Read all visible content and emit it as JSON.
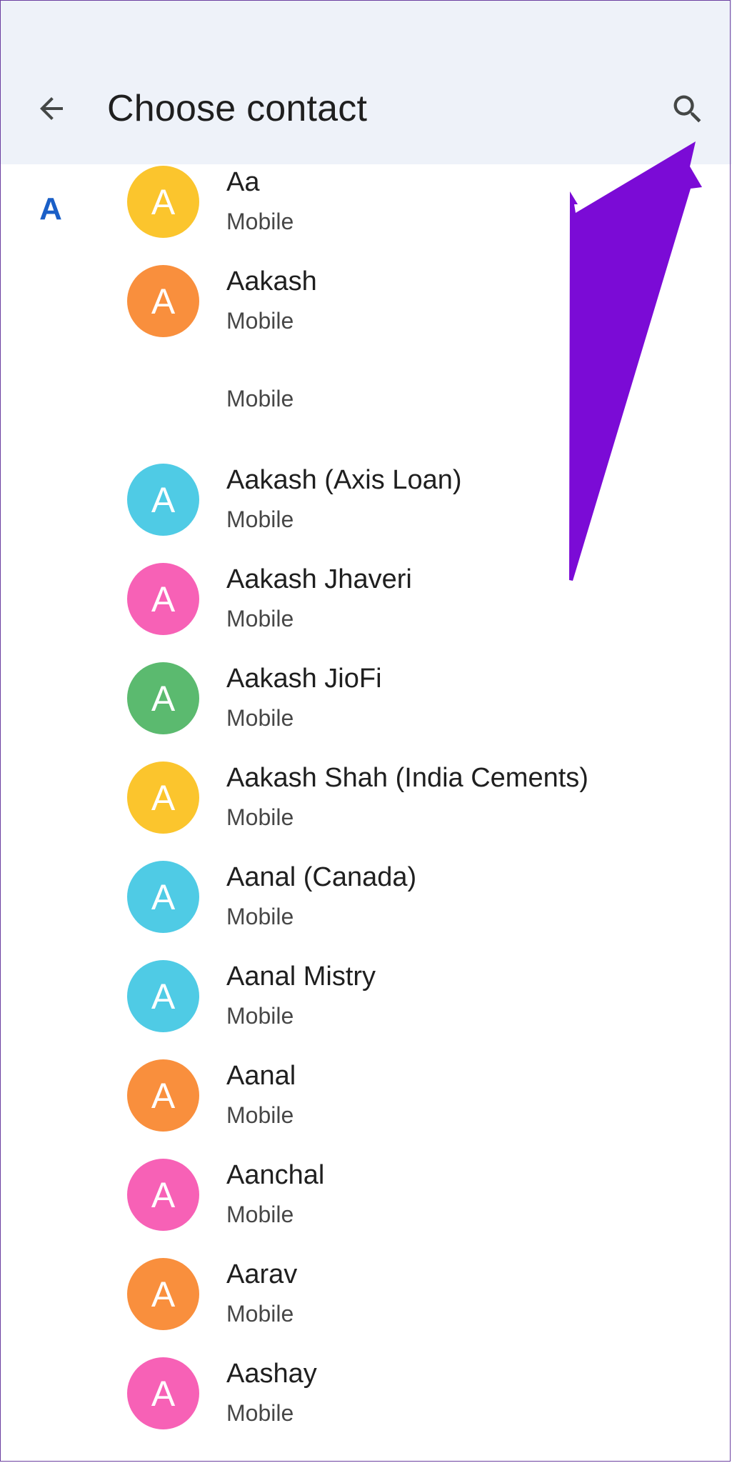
{
  "header": {
    "title": "Choose contact",
    "back_icon": "arrow-left-icon",
    "search_icon": "search-icon"
  },
  "section": {
    "letter": "A"
  },
  "annotation": {
    "arrow_color": "#7b0bd6",
    "arrow_icon": "pointer-arrow"
  },
  "contacts": [
    {
      "name": "Aa",
      "type": "Mobile",
      "initial": "A",
      "color": "#fbc52d"
    },
    {
      "name": "Aakash",
      "type": "Mobile",
      "initial": "A",
      "color": "#f98f3d"
    },
    {
      "name": "",
      "type": "Mobile",
      "initial": "",
      "color": ""
    },
    {
      "name": "Aakash (Axis Loan)",
      "type": "Mobile",
      "initial": "A",
      "color": "#4fcbe5"
    },
    {
      "name": "Aakash Jhaveri",
      "type": "Mobile",
      "initial": "A",
      "color": "#f761b6"
    },
    {
      "name": "Aakash JioFi",
      "type": "Mobile",
      "initial": "A",
      "color": "#5bba6f"
    },
    {
      "name": "Aakash Shah (India Cements)",
      "type": "Mobile",
      "initial": "A",
      "color": "#fbc52d"
    },
    {
      "name": "Aanal (Canada)",
      "type": "Mobile",
      "initial": "A",
      "color": "#4fcbe5"
    },
    {
      "name": "Aanal Mistry",
      "type": "Mobile",
      "initial": "A",
      "color": "#4fcbe5"
    },
    {
      "name": "Aanal",
      "type": "Mobile",
      "initial": "A",
      "color": "#f98f3d"
    },
    {
      "name": "Aanchal",
      "type": "Mobile",
      "initial": "A",
      "color": "#f761b6"
    },
    {
      "name": "Aarav",
      "type": "Mobile",
      "initial": "A",
      "color": "#f98f3d"
    },
    {
      "name": "Aashay",
      "type": "Mobile",
      "initial": "A",
      "color": "#f761b6"
    }
  ]
}
